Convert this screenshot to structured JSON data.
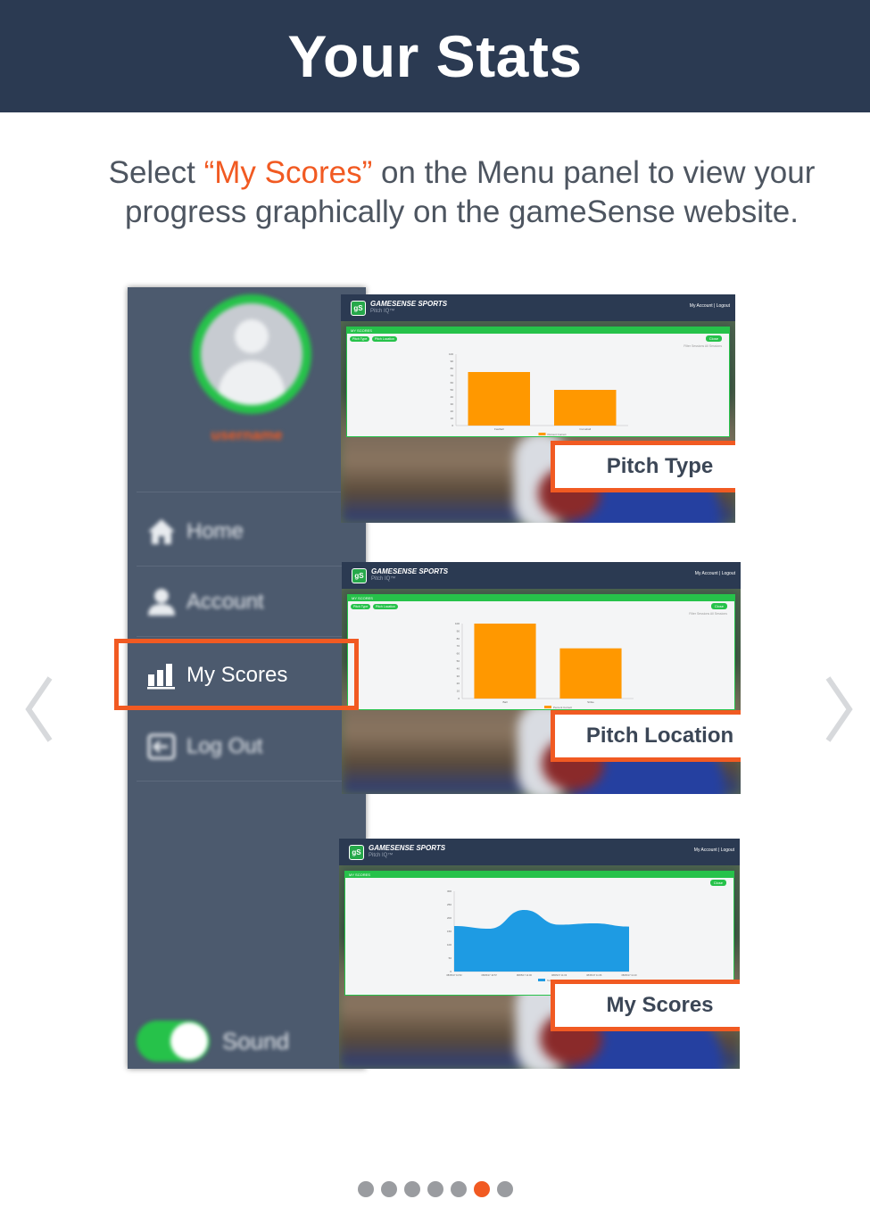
{
  "header": {
    "title": "Your Stats"
  },
  "intro": {
    "prefix": "Select ",
    "highlight": "“My Scores”",
    "suffix": " on the Menu panel to view your progress graphically on the gameSense website."
  },
  "menu": {
    "username": "username",
    "items": [
      {
        "label": "Home",
        "icon": "home-icon",
        "active": false
      },
      {
        "label": "Account",
        "icon": "user-icon",
        "active": false
      },
      {
        "label": "My Scores",
        "icon": "bar-chart-icon",
        "active": true
      },
      {
        "label": "Log Out",
        "icon": "logout-icon",
        "active": false
      }
    ],
    "sound_label": "Sound",
    "sound_on": true
  },
  "app": {
    "brand": "GAMESENSE SPORTS",
    "brand_sub": "Pitch IQ™",
    "links": "My Account | Logout",
    "panel_title": "MY SCORES",
    "tab_pitch_type": "Pitch Type",
    "tab_pitch_location": "Pitch Location",
    "close_label": "Close",
    "filter_label": "Filter Sessions",
    "filter_value": "All Sessions"
  },
  "callouts": {
    "pitch_type": "Pitch Type",
    "pitch_location": "Pitch Location",
    "my_scores": "My Scores"
  },
  "chart_data": [
    {
      "type": "bar",
      "categories": [
        "Fastball",
        "Curveball"
      ],
      "values": [
        75,
        50
      ],
      "ylim": [
        0,
        100
      ],
      "yticks": [
        0,
        10,
        20,
        30,
        40,
        50,
        60,
        70,
        80,
        90,
        100
      ],
      "color": "#ff9800",
      "legend": "Percent Correct"
    },
    {
      "type": "bar",
      "categories": [
        "Ball",
        "Strike"
      ],
      "values": [
        100,
        67
      ],
      "ylim": [
        0,
        100
      ],
      "yticks": [
        0,
        10,
        20,
        30,
        40,
        50,
        60,
        70,
        80,
        90,
        100
      ],
      "color": "#ff9800",
      "legend": "Percent Correct"
    },
    {
      "type": "area",
      "x": [
        "08/05/17 10:52",
        "08/05/17 10:57",
        "08/05/17 11:00",
        "08/05/17 11:03",
        "08/05/17 11:06",
        "08/05/17 11:10"
      ],
      "values": [
        170,
        160,
        230,
        175,
        180,
        168
      ],
      "ylim": [
        0,
        300
      ],
      "yticks": [
        0,
        50,
        100,
        150,
        200,
        250,
        300
      ],
      "color": "#1e9be3",
      "legend": "Total Score"
    }
  ],
  "pagination": {
    "count": 7,
    "active_index": 5
  },
  "colors": {
    "accent": "#f15a22",
    "header": "#2b3a52",
    "green": "#26c24a",
    "panel": "#4c5a6e"
  }
}
